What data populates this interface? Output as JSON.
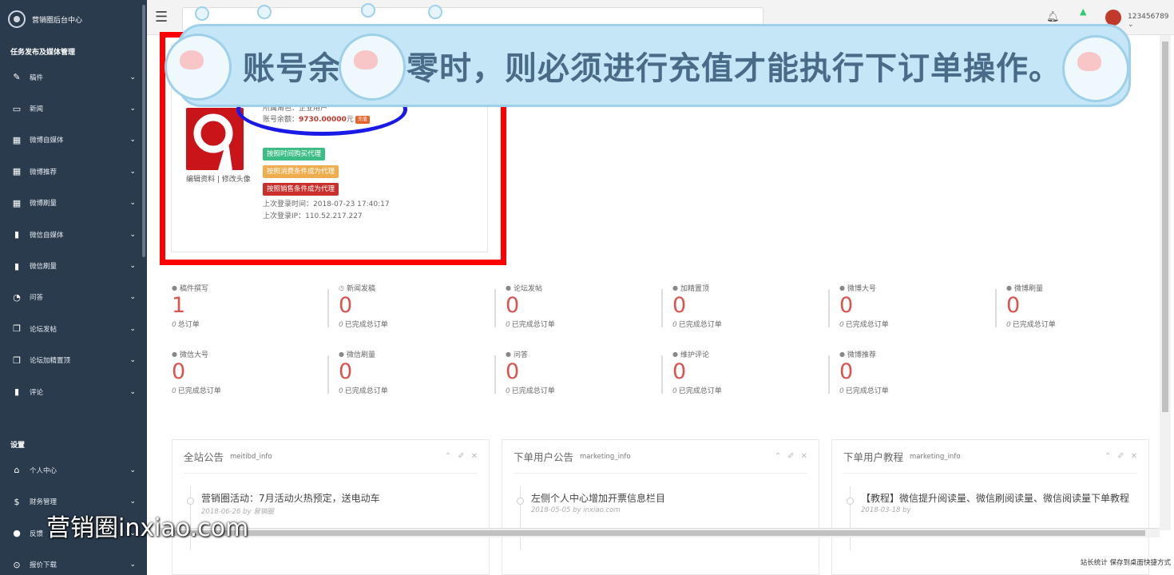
{
  "sidebar": {
    "brand": "营销圈后台中心",
    "section1": "任务发布及媒体管理",
    "items": [
      {
        "label": "稿件",
        "icon": "edit-icon"
      },
      {
        "label": "新闻",
        "icon": "monitor-icon"
      },
      {
        "label": "微博自媒体",
        "icon": "grid-icon"
      },
      {
        "label": "微博推荐",
        "icon": "grid-icon"
      },
      {
        "label": "微博刷量",
        "icon": "grid-icon"
      },
      {
        "label": "微信自媒体",
        "icon": "bar-chart-icon"
      },
      {
        "label": "微信刷量",
        "icon": "bar-chart-icon"
      },
      {
        "label": "问答",
        "icon": "comments-icon"
      },
      {
        "label": "论坛发帖",
        "icon": "copy-icon"
      },
      {
        "label": "论坛加精置顶",
        "icon": "copy-icon"
      },
      {
        "label": "评论",
        "icon": "bookmark-icon"
      }
    ],
    "section2": "设置",
    "items2": [
      {
        "label": "个人中心",
        "icon": "home-icon"
      },
      {
        "label": "财务管理",
        "icon": "dollar-icon"
      },
      {
        "label": "反馈",
        "icon": "chat-icon"
      },
      {
        "label": "报价下载",
        "icon": "download-icon"
      }
    ]
  },
  "topbar": {
    "username": "123456789"
  },
  "profile": {
    "role_label": "所属角色：",
    "role_value": "企业用户",
    "balance_label": "账号余额：",
    "balance_value": "9730.00000",
    "balance_unit": "元",
    "recharge_label": "充值",
    "edit_links": "编辑资料 | 修改头像",
    "agent_buttons": [
      "按照时间购买代理",
      "按照消费条件成为代理",
      "按照销售条件成为代理"
    ],
    "last_login_time_label": "上次登录时间：",
    "last_login_time": "2018-07-23 17:40:17",
    "last_login_ip_label": "上次登录IP：",
    "last_login_ip": "110.52.217.227"
  },
  "stats": [
    {
      "title": "稿件撰写",
      "value": "1",
      "sub_num": "0",
      "sub": "总订单"
    },
    {
      "title": "新闻发稿",
      "value": "0",
      "sub_num": "0",
      "sub": "已完成总订单"
    },
    {
      "title": "论坛发帖",
      "value": "0",
      "sub_num": "0",
      "sub": "已完成总订单"
    },
    {
      "title": "加精置顶",
      "value": "0",
      "sub_num": "0",
      "sub": "已完成总订单"
    },
    {
      "title": "微博大号",
      "value": "0",
      "sub_num": "0",
      "sub": "已完成总订单"
    },
    {
      "title": "微博刷量",
      "value": "0",
      "sub_num": "0",
      "sub": "已完成总订单"
    },
    {
      "title": "微信大号",
      "value": "0",
      "sub_num": "0",
      "sub": "已完成总订单"
    },
    {
      "title": "微信刷量",
      "value": "0",
      "sub_num": "0",
      "sub": "已完成总订单"
    },
    {
      "title": "问答",
      "value": "0",
      "sub_num": "0",
      "sub": "已完成总订单"
    },
    {
      "title": "维护评论",
      "value": "0",
      "sub_num": "0",
      "sub": "已完成总订单"
    },
    {
      "title": "微博推荐",
      "value": "0",
      "sub_num": "0",
      "sub": "已完成总订单"
    }
  ],
  "panels": [
    {
      "title": "全站公告",
      "sub": "meitibd_info",
      "entry": "营销圈活动：7月活动火热预定，送电动车",
      "date": "2018-06-26",
      "by": "by",
      "author": "营销圈"
    },
    {
      "title": "下单用户公告",
      "sub": "marketing_info",
      "entry": "左侧个人中心增加开票信息栏目",
      "date": "2018-05-05",
      "by": "by",
      "author": "inxiao.com"
    },
    {
      "title": "下单用户教程",
      "sub": "marketing_info",
      "entry": "【教程】微信提升阅读量、微信刷阅读量、微信阅读量下单教程",
      "date": "2018-03-18",
      "by": "by",
      "author": ""
    }
  ],
  "footer": "站长统计 保存到桌面快捷方式",
  "overlay": {
    "banner_text": "账号余额为零时，则必须进行充值才能执行下订单操作。",
    "watermark": "营销圈inxiao.com"
  }
}
